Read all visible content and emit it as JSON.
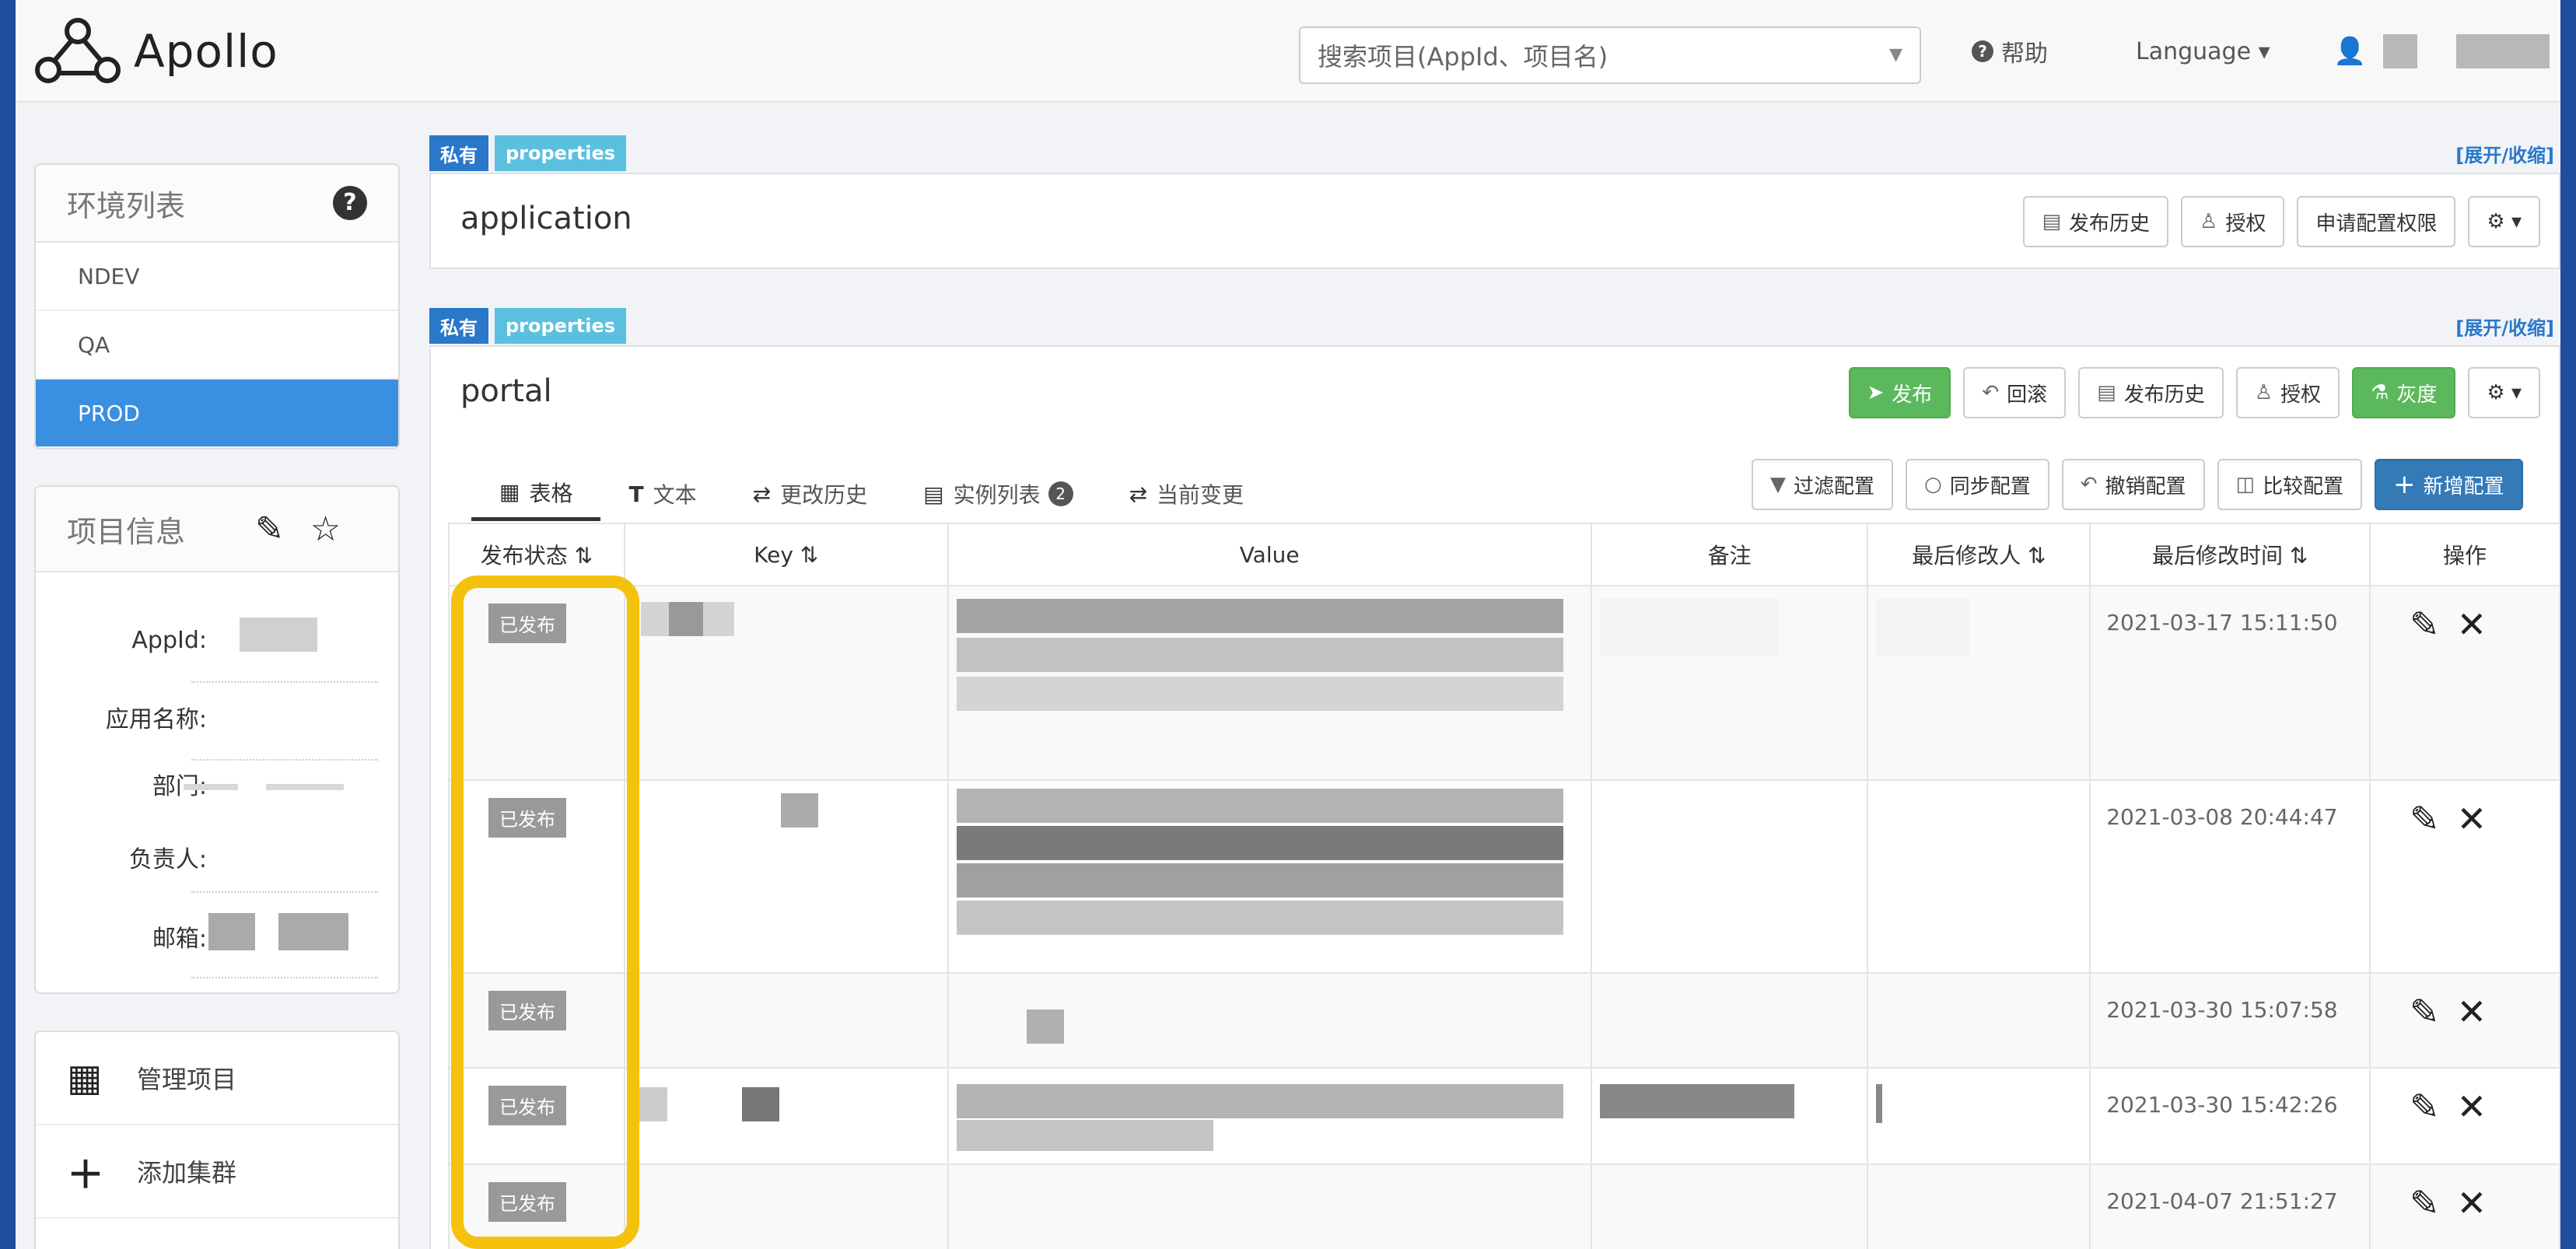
{
  "nav": {
    "brand": "Apollo",
    "search_placeholder": "搜索项目(AppId、项目名)",
    "help": "帮助",
    "language": "Language ▾"
  },
  "sidebar": {
    "env_title": "环境列表",
    "envs": [
      "NDEV",
      "QA",
      "PROD"
    ],
    "active_env": "PROD",
    "info_title": "项目信息",
    "info_labels": [
      "AppId:",
      "应用名称:",
      "部门:",
      "负责人:",
      "邮箱:"
    ],
    "menu": [
      {
        "icon": "apps-icon",
        "label": "管理项目"
      },
      {
        "icon": "plus-icon",
        "label": "添加集群"
      }
    ]
  },
  "namespaces": [
    {
      "tag_private": "私有",
      "tag_format": "properties",
      "expand": "[展开/收缩]",
      "name": "application",
      "buttons": [
        "发布历史",
        "授权",
        "申请配置权限"
      ]
    },
    {
      "tag_private": "私有",
      "tag_format": "properties",
      "expand": "[展开/收缩]",
      "name": "portal",
      "buttons": {
        "publish": "发布",
        "rollback": "回滚",
        "history": "发布历史",
        "auth": "授权",
        "gray": "灰度"
      }
    }
  ],
  "tabs": [
    {
      "label": "表格",
      "active": true
    },
    {
      "label": "文本",
      "active": false
    },
    {
      "label": "更改历史",
      "active": false
    },
    {
      "label": "实例列表",
      "active": false,
      "badge": "2"
    },
    {
      "label": "当前变更",
      "active": false
    }
  ],
  "toolbar": {
    "filter": "过滤配置",
    "sync": "同步配置",
    "revoke": "撤销配置",
    "compare": "比较配置",
    "add": "新增配置"
  },
  "table": {
    "headers": [
      "发布状态 ⇅",
      "Key ⇅",
      "Value",
      "备注",
      "最后修改人 ⇅",
      "最后修改时间 ⇅",
      "操作"
    ],
    "rows": [
      {
        "status": "已发布",
        "time": "2021-03-17 15:11:50"
      },
      {
        "status": "已发布",
        "time": "2021-03-08 20:44:47"
      },
      {
        "status": "已发布",
        "time": "2021-03-30 15:07:58"
      },
      {
        "status": "已发布",
        "time": "2021-03-30 15:42:26"
      },
      {
        "status": "已发布",
        "time": "2021-04-07 21:51:27"
      }
    ]
  },
  "colors": {
    "primary": "#337ab7",
    "green": "#5cb85c",
    "active_env": "#3a8fe0",
    "highlight": "#f4c20d"
  }
}
